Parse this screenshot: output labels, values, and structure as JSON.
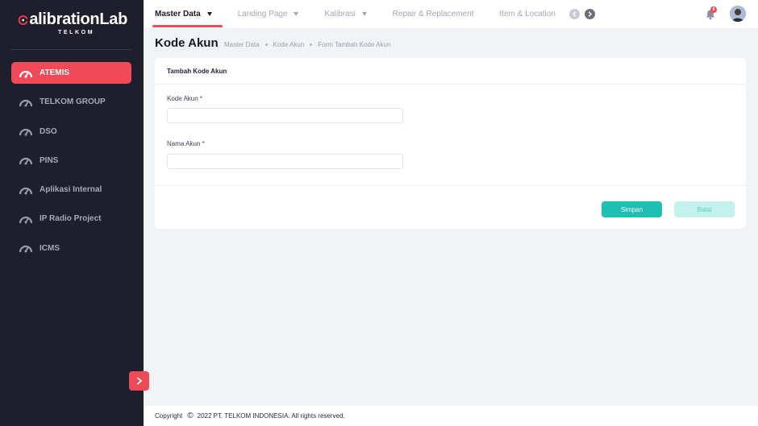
{
  "brand": {
    "logo_initial": "C",
    "logo_text": "alibrationLab",
    "logo_sub": "TELKOM"
  },
  "sidebar": {
    "items": [
      {
        "label": "ATEMIS",
        "icon": "gauge-icon",
        "active": true
      },
      {
        "label": "TELKOM GROUP",
        "icon": "gauge-icon",
        "active": false
      },
      {
        "label": "DSO",
        "icon": "gauge-icon",
        "active": false
      },
      {
        "label": "PINS",
        "icon": "gauge-icon",
        "active": false
      },
      {
        "label": "Aplikasi Internal",
        "icon": "gauge-icon",
        "active": false
      },
      {
        "label": "IP Radio Project",
        "icon": "gauge-icon",
        "active": false
      },
      {
        "label": "ICMS",
        "icon": "gauge-icon",
        "active": false
      }
    ],
    "collapse_icon": "chevron-right-icon"
  },
  "topbar": {
    "menu": [
      {
        "label": "Master Data",
        "has_caret": true,
        "active": true
      },
      {
        "label": "Landing Page",
        "has_caret": true,
        "active": false
      },
      {
        "label": "Kalibrasi",
        "has_caret": true,
        "active": false
      },
      {
        "label": "Repair & Replacement",
        "has_caret": false,
        "active": false
      },
      {
        "label": "Item & Location",
        "has_caret": false,
        "active": false
      }
    ],
    "notification_count": "8"
  },
  "page": {
    "title": "Kode Akun",
    "breadcrumb": [
      "Master Data",
      "Kode Akun",
      "Form Tambah Kode Akun"
    ]
  },
  "form": {
    "header": "Tambah Kode Akun",
    "fields": [
      {
        "label": "Kode Akun *",
        "value": "",
        "placeholder": ""
      },
      {
        "label": "Nama Akun *",
        "value": "",
        "placeholder": ""
      }
    ],
    "save_label": "Simpan",
    "cancel_label": "Batal"
  },
  "footer": {
    "prefix": "Copyright",
    "text": "2022 PT. TELKOM INDONESIA. All rights reserved."
  },
  "colors": {
    "accent": "#f04958",
    "sidebar_bg": "#1e1e2d",
    "primary_button": "#1fc0b3",
    "secondary_button": "#c3f1ec"
  }
}
